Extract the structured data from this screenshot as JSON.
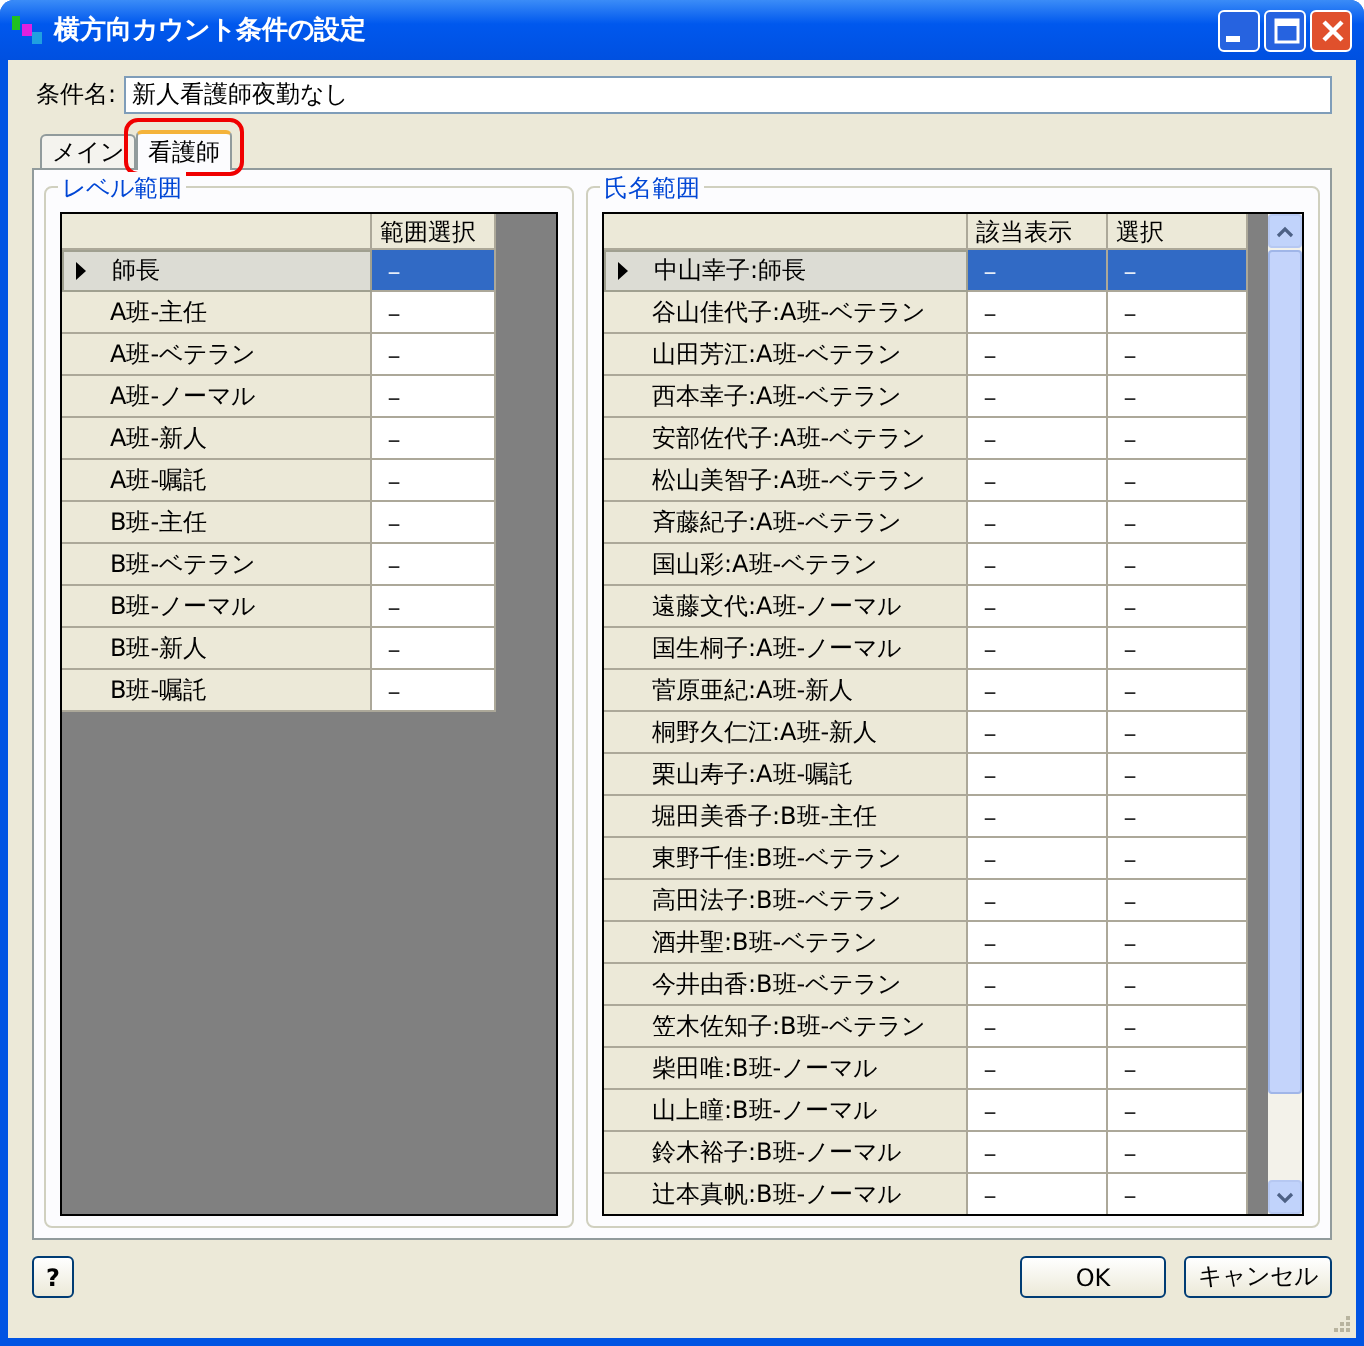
{
  "window": {
    "title": "横方向カウント条件の設定"
  },
  "name_field": {
    "label": "条件名:",
    "value": "新人看護師夜勤なし"
  },
  "tabs": [
    {
      "label": "メイン",
      "selected": false,
      "highlighted": false
    },
    {
      "label": "看護師",
      "selected": true,
      "highlighted": true
    }
  ],
  "level_range": {
    "title": "レベル範囲",
    "columns": [
      "範囲選択"
    ],
    "rows": [
      {
        "name": "師長",
        "selected": true,
        "cells": [
          "－"
        ]
      },
      {
        "name": "A班-主任",
        "selected": false,
        "cells": [
          "－"
        ]
      },
      {
        "name": "A班-ベテラン",
        "selected": false,
        "cells": [
          "－"
        ]
      },
      {
        "name": "A班-ノーマル",
        "selected": false,
        "cells": [
          "－"
        ]
      },
      {
        "name": "A班-新人",
        "selected": false,
        "cells": [
          "－"
        ]
      },
      {
        "name": "A班-嘱託",
        "selected": false,
        "cells": [
          "－"
        ]
      },
      {
        "name": "B班-主任",
        "selected": false,
        "cells": [
          "－"
        ]
      },
      {
        "name": "B班-ベテラン",
        "selected": false,
        "cells": [
          "－"
        ]
      },
      {
        "name": "B班-ノーマル",
        "selected": false,
        "cells": [
          "－"
        ]
      },
      {
        "name": "B班-新人",
        "selected": false,
        "cells": [
          "－"
        ]
      },
      {
        "name": "B班-嘱託",
        "selected": false,
        "cells": [
          "－"
        ]
      }
    ]
  },
  "name_range": {
    "title": "氏名範囲",
    "columns": [
      "該当表示",
      "選択"
    ],
    "rows": [
      {
        "name": "中山幸子:師長",
        "selected": true,
        "cells": [
          "－",
          "－"
        ]
      },
      {
        "name": "谷山佳代子:A班-ベテラン",
        "selected": false,
        "cells": [
          "－",
          "－"
        ]
      },
      {
        "name": "山田芳江:A班-ベテラン",
        "selected": false,
        "cells": [
          "－",
          "－"
        ]
      },
      {
        "name": "西本幸子:A班-ベテラン",
        "selected": false,
        "cells": [
          "－",
          "－"
        ]
      },
      {
        "name": "安部佐代子:A班-ベテラン",
        "selected": false,
        "cells": [
          "－",
          "－"
        ]
      },
      {
        "name": "松山美智子:A班-ベテラン",
        "selected": false,
        "cells": [
          "－",
          "－"
        ]
      },
      {
        "name": "斉藤紀子:A班-ベテラン",
        "selected": false,
        "cells": [
          "－",
          "－"
        ]
      },
      {
        "name": "国山彩:A班-ベテラン",
        "selected": false,
        "cells": [
          "－",
          "－"
        ]
      },
      {
        "name": "遠藤文代:A班-ノーマル",
        "selected": false,
        "cells": [
          "－",
          "－"
        ]
      },
      {
        "name": "国生桐子:A班-ノーマル",
        "selected": false,
        "cells": [
          "－",
          "－"
        ]
      },
      {
        "name": "菅原亜紀:A班-新人",
        "selected": false,
        "cells": [
          "－",
          "－"
        ]
      },
      {
        "name": "桐野久仁江:A班-新人",
        "selected": false,
        "cells": [
          "－",
          "－"
        ]
      },
      {
        "name": "栗山寿子:A班-嘱託",
        "selected": false,
        "cells": [
          "－",
          "－"
        ]
      },
      {
        "name": "堀田美香子:B班-主任",
        "selected": false,
        "cells": [
          "－",
          "－"
        ]
      },
      {
        "name": "東野千佳:B班-ベテラン",
        "selected": false,
        "cells": [
          "－",
          "－"
        ]
      },
      {
        "name": "高田法子:B班-ベテラン",
        "selected": false,
        "cells": [
          "－",
          "－"
        ]
      },
      {
        "name": "酒井聖:B班-ベテラン",
        "selected": false,
        "cells": [
          "－",
          "－"
        ]
      },
      {
        "name": "今井由香:B班-ベテラン",
        "selected": false,
        "cells": [
          "－",
          "－"
        ]
      },
      {
        "name": "笠木佐知子:B班-ベテラン",
        "selected": false,
        "cells": [
          "－",
          "－"
        ]
      },
      {
        "name": "柴田唯:B班-ノーマル",
        "selected": false,
        "cells": [
          "－",
          "－"
        ]
      },
      {
        "name": "山上瞳:B班-ノーマル",
        "selected": false,
        "cells": [
          "－",
          "－"
        ]
      },
      {
        "name": "鈴木裕子:B班-ノーマル",
        "selected": false,
        "cells": [
          "－",
          "－"
        ]
      },
      {
        "name": "辻本真帆:B班-ノーマル",
        "selected": false,
        "cells": [
          "－",
          "－"
        ]
      }
    ]
  },
  "buttons": {
    "help": "?",
    "ok": "OK",
    "cancel": "キャンセル"
  }
}
